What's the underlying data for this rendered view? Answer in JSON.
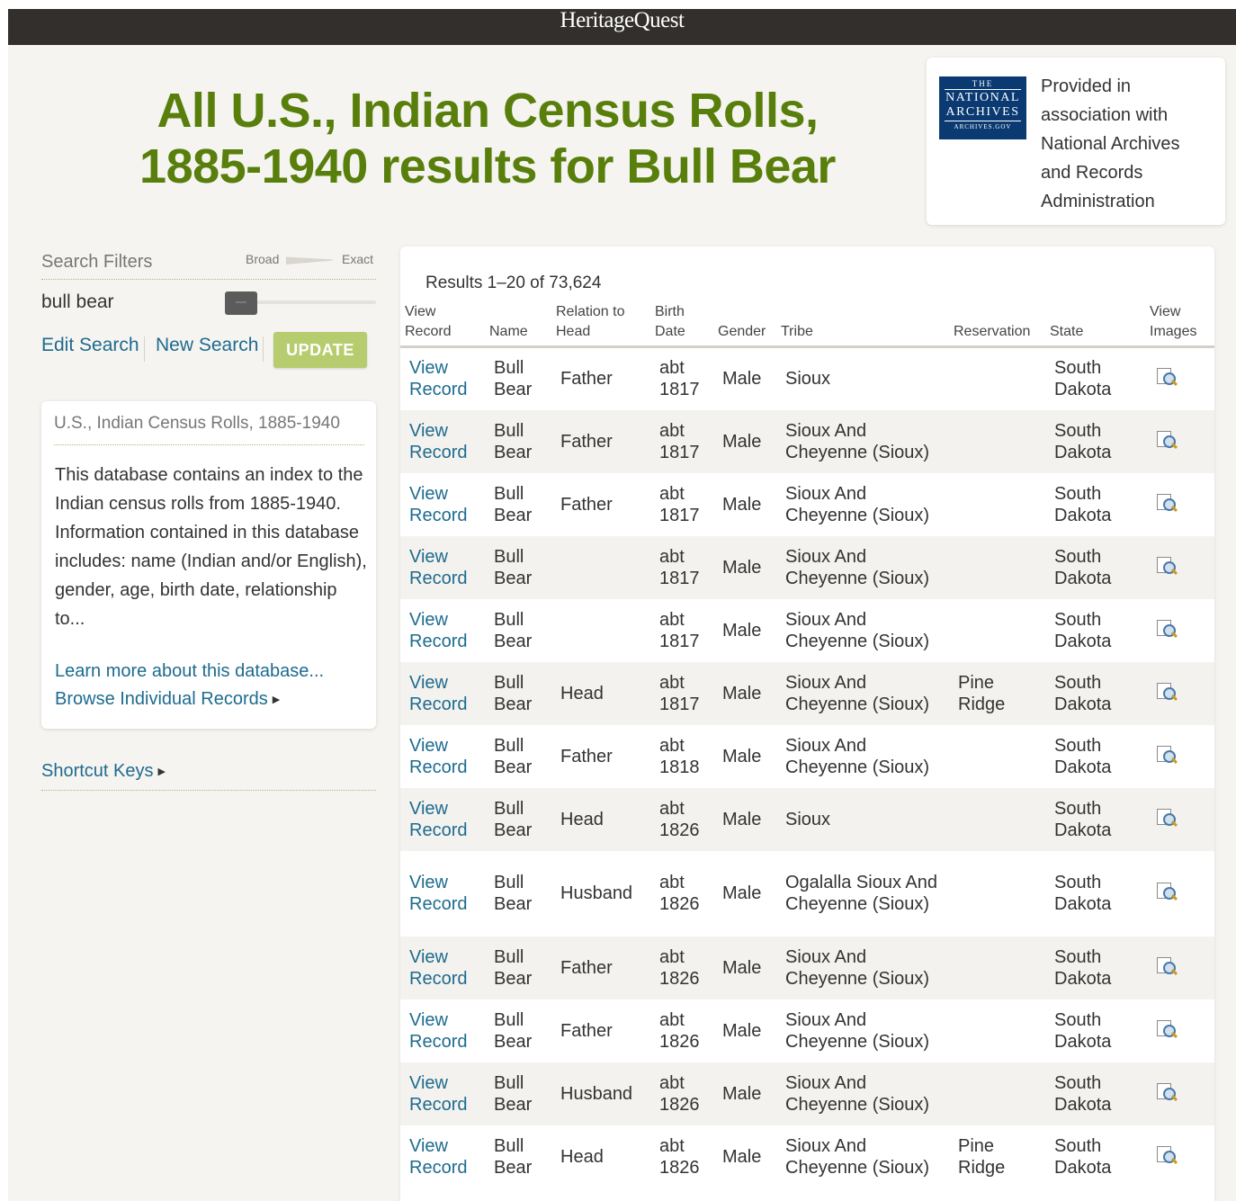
{
  "header": {
    "brand": "HeritageQuest"
  },
  "page": {
    "title_line1": "All U.S., Indian Census Rolls,",
    "title_line2": "1885-1940 results for Bull Bear"
  },
  "partner": {
    "logo_line1": "THE",
    "logo_line2": "NATIONAL",
    "logo_line3": "ARCHIVES",
    "logo_line4": "ARCHIVES.GOV",
    "text": "Provided in association with National Archives and Records Administration"
  },
  "filters": {
    "title": "Search Filters",
    "broad_label": "Broad",
    "exact_label": "Exact",
    "term": "bull bear",
    "slider_level": 0,
    "edit_search": "Edit Search",
    "new_search": "New Search",
    "update": "UPDATE"
  },
  "database": {
    "title": "U.S., Indian Census Rolls, 1885-1940",
    "description": "This database contains an index to the Indian census rolls from 1885-1940. Information contained in this database includes: name (Indian and/or English), gender, age, birth date, relationship to...",
    "learn_more": "Learn more about this database...",
    "browse": "Browse Individual Records"
  },
  "shortcut_keys": "Shortcut Keys",
  "results": {
    "count_text": "Results 1–20 of 73,624",
    "columns": [
      {
        "key": "view_record",
        "label": "View Record"
      },
      {
        "key": "name",
        "label": "Name"
      },
      {
        "key": "relation",
        "label": "Relation to Head"
      },
      {
        "key": "birth",
        "label": "Birth Date"
      },
      {
        "key": "gender",
        "label": "Gender"
      },
      {
        "key": "tribe",
        "label": "Tribe"
      },
      {
        "key": "reservation",
        "label": "Reservation"
      },
      {
        "key": "state",
        "label": "State"
      },
      {
        "key": "view_images",
        "label": "View Images"
      }
    ],
    "view_label_1": "View",
    "view_label_2": "Record",
    "image_icon": "view-images-icon",
    "rows": [
      {
        "name": "Bull Bear",
        "relation": "Father",
        "birth": "abt 1817",
        "gender": "Male",
        "tribe": "Sioux",
        "reservation": "",
        "state": "South Dakota"
      },
      {
        "name": "Bull Bear",
        "relation": "Father",
        "birth": "abt 1817",
        "gender": "Male",
        "tribe": "Sioux And Cheyenne (Sioux)",
        "reservation": "",
        "state": "South Dakota"
      },
      {
        "name": "Bull Bear",
        "relation": "Father",
        "birth": "abt 1817",
        "gender": "Male",
        "tribe": "Sioux And Cheyenne (Sioux)",
        "reservation": "",
        "state": "South Dakota"
      },
      {
        "name": "Bull Bear",
        "relation": "",
        "birth": "abt 1817",
        "gender": "Male",
        "tribe": "Sioux And Cheyenne (Sioux)",
        "reservation": "",
        "state": "South Dakota"
      },
      {
        "name": "Bull Bear",
        "relation": "",
        "birth": "abt 1817",
        "gender": "Male",
        "tribe": "Sioux And Cheyenne (Sioux)",
        "reservation": "",
        "state": "South Dakota"
      },
      {
        "name": "Bull Bear",
        "relation": "Head",
        "birth": "abt 1817",
        "gender": "Male",
        "tribe": "Sioux And Cheyenne (Sioux)",
        "reservation": "Pine Ridge",
        "state": "South Dakota"
      },
      {
        "name": "Bull Bear",
        "relation": "Father",
        "birth": "abt 1818",
        "gender": "Male",
        "tribe": "Sioux And Cheyenne (Sioux)",
        "reservation": "",
        "state": "South Dakota"
      },
      {
        "name": "Bull Bear",
        "relation": "Head",
        "birth": "abt 1826",
        "gender": "Male",
        "tribe": "Sioux",
        "reservation": "",
        "state": "South Dakota"
      },
      {
        "name": "Bull Bear",
        "relation": "Husband",
        "birth": "abt 1826",
        "gender": "Male",
        "tribe": "Ogalalla Sioux And Cheyenne (Sioux)",
        "reservation": "",
        "state": "South Dakota"
      },
      {
        "name": "Bull Bear",
        "relation": "Father",
        "birth": "abt 1826",
        "gender": "Male",
        "tribe": "Sioux And Cheyenne (Sioux)",
        "reservation": "",
        "state": "South Dakota"
      },
      {
        "name": "Bull Bear",
        "relation": "Father",
        "birth": "abt 1826",
        "gender": "Male",
        "tribe": "Sioux And Cheyenne (Sioux)",
        "reservation": "",
        "state": "South Dakota"
      },
      {
        "name": "Bull Bear",
        "relation": "Husband",
        "birth": "abt 1826",
        "gender": "Male",
        "tribe": "Sioux And Cheyenne (Sioux)",
        "reservation": "",
        "state": "South Dakota"
      },
      {
        "name": "Bull Bear",
        "relation": "Head",
        "birth": "abt 1826",
        "gender": "Male",
        "tribe": "Sioux And Cheyenne (Sioux)",
        "reservation": "Pine Ridge",
        "state": "South Dakota"
      }
    ]
  }
}
